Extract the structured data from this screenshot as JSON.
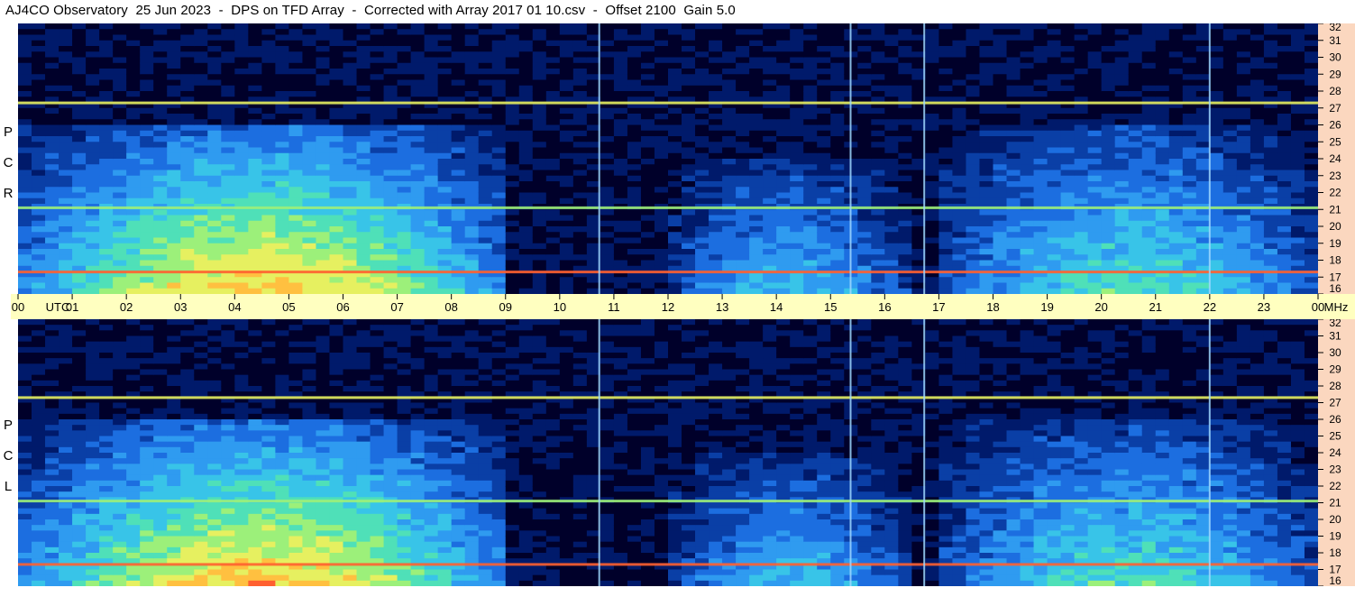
{
  "title": "AJ4CO Observatory  25 Jun 2023  -  DPS on TFD Array  -  Corrected with Array 2017 01 10.csv  -  Offset 2100  Gain 5.0",
  "panels": [
    {
      "id": "rcp",
      "letters": [
        "P",
        "C",
        "R"
      ]
    },
    {
      "id": "lcp",
      "letters": [
        "P",
        "C",
        "L"
      ]
    }
  ],
  "utc_axis": {
    "labels": [
      "00",
      "01",
      "02",
      "03",
      "04",
      "05",
      "06",
      "07",
      "08",
      "09",
      "10",
      "11",
      "12",
      "13",
      "14",
      "15",
      "16",
      "17",
      "18",
      "19",
      "20",
      "21",
      "22",
      "23",
      "00"
    ],
    "unit_label": "UTC",
    "end_unit": "MHz"
  },
  "mhz_axis": {
    "ticks": [
      "32",
      "31",
      "30",
      "29",
      "28",
      "27",
      "26",
      "25",
      "24",
      "23",
      "22",
      "21",
      "20",
      "19",
      "18",
      "17",
      "16"
    ]
  },
  "colors": {
    "background": "#000000",
    "axis_bg_bottom": "#ffffc0",
    "axis_bg_right": "#fbd7bf",
    "colormap": [
      "#00002a",
      "#001a6b",
      "#0a3fa6",
      "#1c6ee0",
      "#2f9bf0",
      "#38c4e8",
      "#4fe0b8",
      "#9cf07a",
      "#e6f060",
      "#ffc040",
      "#ff6030",
      "#ff2fa0"
    ]
  },
  "chart_data": {
    "type": "heatmap",
    "title": "AJ4CO Observatory  25 Jun 2023  -  DPS on TFD Array  -  Corrected with Array 2017 01 10.csv  -  Offset 2100  Gain 5.0",
    "xlabel": "UTC",
    "ylabel": "MHz",
    "xlim": [
      0,
      24
    ],
    "ylim": [
      16,
      32
    ],
    "panels": [
      "RCP",
      "LCP"
    ],
    "x_ticks": [
      "00",
      "01",
      "02",
      "03",
      "04",
      "05",
      "06",
      "07",
      "08",
      "09",
      "10",
      "11",
      "12",
      "13",
      "14",
      "15",
      "16",
      "17",
      "18",
      "19",
      "20",
      "21",
      "22",
      "23",
      "00"
    ],
    "y_ticks": [
      32,
      31,
      30,
      29,
      28,
      27,
      26,
      25,
      24,
      23,
      22,
      21,
      20,
      19,
      18,
      17,
      16
    ],
    "intensity_features": [
      {
        "name": "daytime solar-heated band",
        "x_start": 0.0,
        "x_end": 9.0,
        "y_max": 26.0,
        "level": 0.8
      },
      {
        "name": "evening band",
        "x_start": 12.0,
        "x_end": 16.5,
        "y_max": 24.0,
        "level": 0.45
      },
      {
        "name": "morning band",
        "x_start": 17.0,
        "x_end": 24.0,
        "y_max": 26.0,
        "level": 0.55
      },
      {
        "name": "interference line",
        "freq_mhz": 27.3,
        "level": 0.7
      },
      {
        "name": "interference line",
        "freq_mhz": 17.3,
        "level": 0.9
      },
      {
        "name": "interference line",
        "freq_mhz": 21.1,
        "level": 0.6
      }
    ],
    "vertical_markers_utc": [
      10.73,
      15.37,
      16.73,
      22.0
    ]
  }
}
